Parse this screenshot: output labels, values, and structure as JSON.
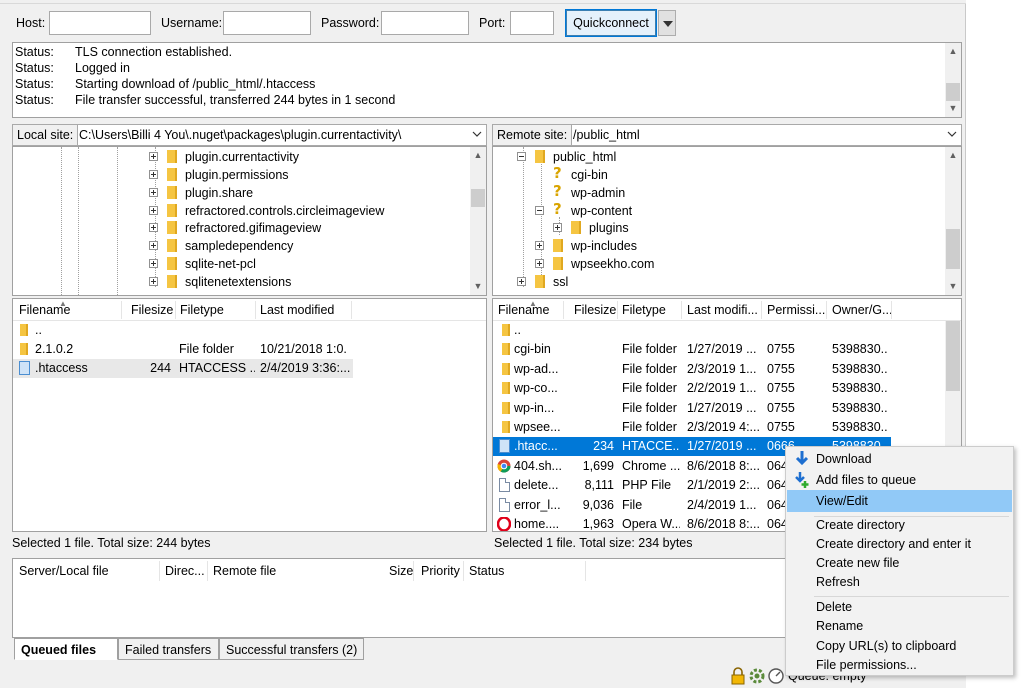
{
  "quickconnect": {
    "host_label": "Host:",
    "username_label": "Username:",
    "password_label": "Password:",
    "port_label": "Port:",
    "host_value": "",
    "username_value": "",
    "password_value": "",
    "port_value": "",
    "button_label": "Quickconnect"
  },
  "log": [
    {
      "key": "Status:",
      "text": "TLS connection established."
    },
    {
      "key": "Status:",
      "text": "Logged in"
    },
    {
      "key": "Status:",
      "text": "Starting download of /public_html/.htaccess"
    },
    {
      "key": "Status:",
      "text": "File transfer successful, transferred 244 bytes in 1 second"
    }
  ],
  "local_site": {
    "label": "Local site:",
    "path": "C:\\Users\\Billi 4 You\\.nuget\\packages\\plugin.currentactivity\\",
    "tree": [
      "plugin.currentactivity",
      "plugin.permissions",
      "plugin.share",
      "refractored.controls.circleimageview",
      "refractored.gifimageview",
      "sampledependency",
      "sqlite-net-pcl",
      "sqlitenetextensions"
    ]
  },
  "remote_site": {
    "label": "Remote site:",
    "path": "/public_html",
    "tree": {
      "root": "public_html",
      "items": [
        "cgi-bin",
        "wp-admin",
        "wp-content",
        "plugins",
        "wp-includes",
        "wpseekho.com"
      ],
      "ssl": "ssl"
    }
  },
  "local_list": {
    "columns": [
      "Filename",
      "Filesize",
      "Filetype",
      "Last modified"
    ],
    "rows": [
      {
        "name": "..",
        "size": "",
        "type": "",
        "modified": ""
      },
      {
        "name": "2.1.0.2",
        "size": "",
        "type": "File folder",
        "modified": "10/21/2018 1:0..."
      },
      {
        "name": ".htaccess",
        "size": "244",
        "type": "HTACCESS ...",
        "modified": "2/4/2019 3:36:..."
      }
    ],
    "status": "Selected 1 file. Total size: 244 bytes"
  },
  "remote_list": {
    "columns": [
      "Filename",
      "Filesize",
      "Filetype",
      "Last modifi...",
      "Permissi...",
      "Owner/G..."
    ],
    "rows": [
      {
        "name": "..",
        "size": "",
        "type": "",
        "modified": "",
        "perm": "",
        "owner": ""
      },
      {
        "name": "cgi-bin",
        "size": "",
        "type": "File folder",
        "modified": "1/27/2019 ...",
        "perm": "0755",
        "owner": "5398830..."
      },
      {
        "name": "wp-ad...",
        "size": "",
        "type": "File folder",
        "modified": "2/3/2019 1...",
        "perm": "0755",
        "owner": "5398830..."
      },
      {
        "name": "wp-co...",
        "size": "",
        "type": "File folder",
        "modified": "2/2/2019 1...",
        "perm": "0755",
        "owner": "5398830..."
      },
      {
        "name": "wp-in...",
        "size": "",
        "type": "File folder",
        "modified": "1/27/2019 ...",
        "perm": "0755",
        "owner": "5398830..."
      },
      {
        "name": "wpsee...",
        "size": "",
        "type": "File folder",
        "modified": "2/3/2019 4:...",
        "perm": "0755",
        "owner": "5398830..."
      },
      {
        "name": ".htacc...",
        "size": "234",
        "type": "HTACCE...",
        "modified": "1/27/2019 ...",
        "perm": "0666",
        "owner": "5398830..."
      },
      {
        "name": "404.sh...",
        "size": "1,699",
        "type": "Chrome ...",
        "modified": "8/6/2018 8:...",
        "perm": "064",
        "owner": ""
      },
      {
        "name": "delete...",
        "size": "8,111",
        "type": "PHP File",
        "modified": "2/1/2019 2:...",
        "perm": "064",
        "owner": ""
      },
      {
        "name": "error_l...",
        "size": "9,036",
        "type": "File",
        "modified": "2/4/2019 1...",
        "perm": "064",
        "owner": ""
      },
      {
        "name": "home....",
        "size": "1,963",
        "type": "Opera W...",
        "modified": "8/6/2018 8:...",
        "perm": "064",
        "owner": ""
      }
    ],
    "status": "Selected 1 file. Total size: 234 bytes"
  },
  "queue": {
    "columns": [
      "Server/Local file",
      "Direc...",
      "Remote file",
      "Size",
      "Priority",
      "Status"
    ],
    "tabs": [
      "Queued files",
      "Failed transfers",
      "Successful transfers (2)"
    ]
  },
  "context_menu": {
    "items": [
      "Download",
      "Add files to queue",
      "View/Edit",
      "Create directory",
      "Create directory and enter it",
      "Create new file",
      "Refresh",
      "Delete",
      "Rename",
      "Copy URL(s) to clipboard",
      "File permissions..."
    ]
  },
  "statusbar": {
    "queue_text": "Queue: empty"
  },
  "colors": {
    "selection": "#0078d7",
    "menu_highlight": "#91c9f7",
    "folder": "#f5c542"
  }
}
